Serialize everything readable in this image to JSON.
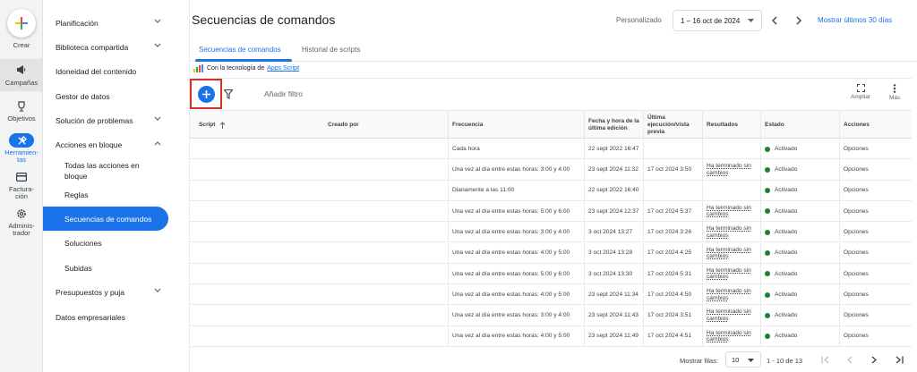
{
  "rail": {
    "create_label": "Crear",
    "items": [
      {
        "label": "Campañas",
        "icon": "megaphone-icon"
      },
      {
        "label": "Objetivos",
        "icon": "trophy-icon"
      },
      {
        "label": "Herramien-",
        "label2": "tas",
        "icon": "tools-icon"
      },
      {
        "label": "Factura-",
        "label2": "ción",
        "icon": "credit-card-icon"
      },
      {
        "label": "Adminis-",
        "label2": "trador",
        "icon": "gear-icon"
      }
    ]
  },
  "sidebar": {
    "items": [
      {
        "label": "Planificación"
      },
      {
        "label": "Biblioteca compartida"
      },
      {
        "label": "Idoneidad del contenido"
      },
      {
        "label": "Gestor de datos"
      },
      {
        "label": "Solución de problemas"
      },
      {
        "label": "Acciones en bloque"
      },
      {
        "label": "Todas las acciones en",
        "label2": "bloque"
      },
      {
        "label": "Reglas"
      },
      {
        "label": "Secuencias de comandos"
      },
      {
        "label": "Soluciones"
      },
      {
        "label": "Subidas"
      },
      {
        "label": "Presupuestos y puja"
      },
      {
        "label": "Datos empresariales"
      }
    ]
  },
  "header": {
    "title": "Secuencias de comandos",
    "personalizado": "Personalizado",
    "date_range": "1 – 16 oct de 2024",
    "show_last": "Mostrar últimos 30 días"
  },
  "tabs": [
    "Secuencias de comandos",
    "Historial de scripts"
  ],
  "powered": {
    "prefix": "Con la tecnología de",
    "link": "Apps Script"
  },
  "toolbar": {
    "add_filter": "Añadir filtro",
    "expand": "Ampliar",
    "more": "Más"
  },
  "table": {
    "headers": [
      "Script",
      "Creado por",
      "Frecuencia",
      "Fecha y hora de la última edición",
      "Última ejecución/vista previa",
      "Resultados",
      "Estado",
      "Acciones"
    ],
    "rows": [
      {
        "frecuencia": "Cada hora",
        "edicion": "22 sept 2022 16:47",
        "ejecucion": "",
        "resultados": "",
        "estado": "Activado",
        "acciones": "Opciones"
      },
      {
        "frecuencia": "Una vez al día entre estas horas: 3:00 y 4:00",
        "edicion": "23 sept 2024 11:32",
        "ejecucion": "17 oct 2024 3:50",
        "resultados": "Ha terminado sin cambios",
        "estado": "Activado",
        "acciones": "Opciones"
      },
      {
        "frecuencia": "Diariamente a las 11:00",
        "edicion": "22 sept 2022 16:40",
        "ejecucion": "",
        "resultados": "",
        "estado": "Activado",
        "acciones": "Opciones"
      },
      {
        "frecuencia": "Una vez al día entre estas horas: 5:00 y 6:00",
        "edicion": "23 sept 2024 12:37",
        "ejecucion": "17 oct 2024 5:37",
        "resultados": "Ha terminado sin cambios",
        "estado": "Activado",
        "acciones": "Opciones"
      },
      {
        "frecuencia": "Una vez al día entre estas horas: 3:00 y 4:00",
        "edicion": "3 oct 2024 13:27",
        "ejecucion": "17 oct 2024 3:26",
        "resultados": "Ha terminado sin cambios",
        "estado": "Activado",
        "acciones": "Opciones"
      },
      {
        "frecuencia": "Una vez al día entre estas horas: 4:00 y 5:00",
        "edicion": "3 oct 2024 13:28",
        "ejecucion": "17 oct 2024 4:25",
        "resultados": "Ha terminado sin cambios",
        "estado": "Activado",
        "acciones": "Opciones"
      },
      {
        "frecuencia": "Una vez al día entre estas horas: 5:00 y 6:00",
        "edicion": "3 oct 2024 13:30",
        "ejecucion": "17 oct 2024 5:31",
        "resultados": "Ha terminado sin cambios",
        "estado": "Activado",
        "acciones": "Opciones"
      },
      {
        "frecuencia": "Una vez al día entre estas horas: 4:00 y 5:00",
        "edicion": "23 sept 2024 11:34",
        "ejecucion": "17 oct 2024 4:50",
        "resultados": "Ha terminado sin cambios",
        "estado": "Activado",
        "acciones": "Opciones"
      },
      {
        "frecuencia": "Una vez al día entre estas horas: 3:00 y 4:00",
        "edicion": "23 sept 2024 11:43",
        "ejecucion": "17 oct 2024 3:51",
        "resultados": "Ha terminado sin cambios",
        "estado": "Activado",
        "acciones": "Opciones"
      },
      {
        "frecuencia": "Una vez al día entre estas horas: 4:00 y 5:00",
        "edicion": "23 sept 2024 11:49",
        "ejecucion": "17 oct 2024 4:51",
        "resultados": "Ha terminado sin cambios",
        "estado": "Activado",
        "acciones": "Opciones"
      }
    ]
  },
  "footer": {
    "rows_label": "Mostrar filas:",
    "rows_value": "10",
    "range": "1 - 10 de 13"
  },
  "colors": {
    "accent": "#1a73e8",
    "status_green": "#188038",
    "highlight_red": "#d93025"
  }
}
